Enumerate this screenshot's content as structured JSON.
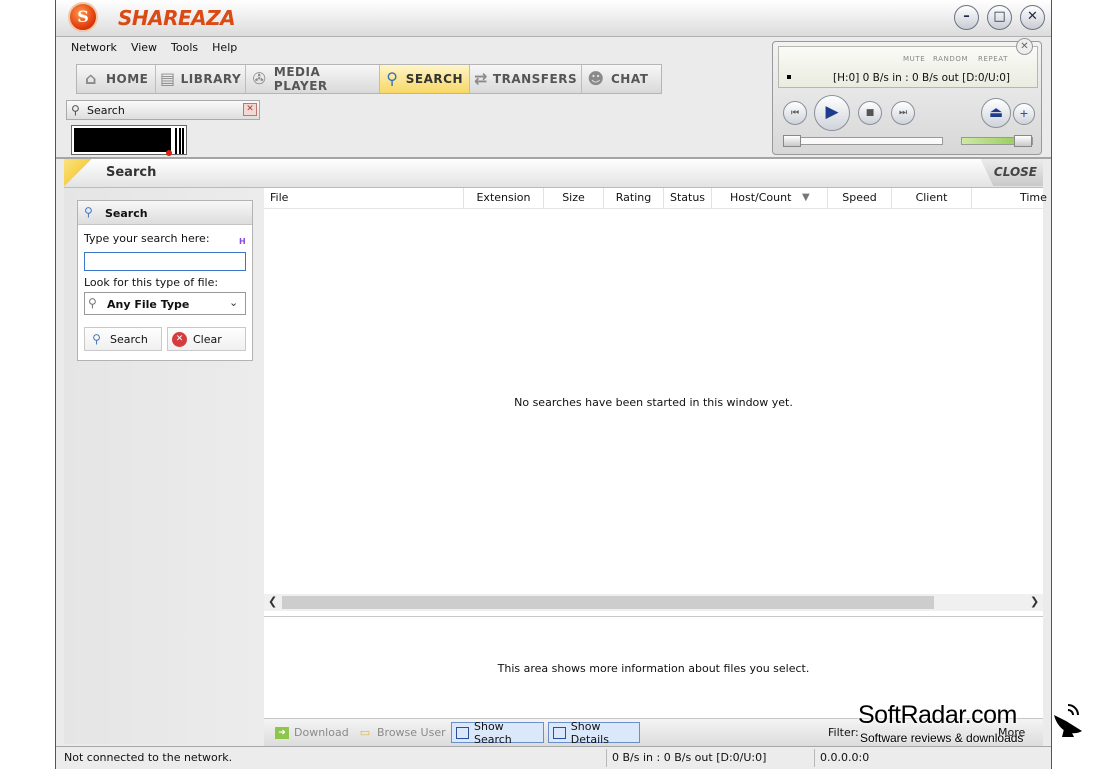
{
  "app": {
    "title": "SHAREAZA",
    "logo_letter": "S"
  },
  "window_controls": {
    "minimize": "–",
    "maximize": "□",
    "close": "✕"
  },
  "menu": [
    "Network",
    "View",
    "Tools",
    "Help"
  ],
  "nav": [
    {
      "label": "HOME",
      "icon": "house-icon"
    },
    {
      "label": "LIBRARY",
      "icon": "folders-icon"
    },
    {
      "label": "MEDIA PLAYER",
      "icon": "film-reel-icon"
    },
    {
      "label": "SEARCH",
      "icon": "magnifier-icon",
      "active": true
    },
    {
      "label": "TRANSFERS",
      "icon": "transfer-arrows-icon"
    },
    {
      "label": "CHAT",
      "icon": "chat-users-icon"
    }
  ],
  "tab": {
    "label": "Search"
  },
  "player": {
    "tags": {
      "mute": "MUTE",
      "random": "RANDOM",
      "repeat": "REPEAT"
    },
    "status": "[H:0] 0 B/s in : 0 B/s out [D:0/U:0]"
  },
  "panel": {
    "title": "Search",
    "close_label": "CLOSE"
  },
  "search_box": {
    "header": "Search",
    "prompt": "Type your search here:",
    "input_value": "",
    "input_placeholder": "",
    "type_label": "Look for this type of file:",
    "file_type": "Any File Type",
    "search_button": "Search",
    "clear_button": "Clear"
  },
  "results": {
    "columns": [
      "File",
      "Extension",
      "Size",
      "Rating",
      "Status",
      "Host/Count",
      "Speed",
      "Client",
      "Time"
    ],
    "sorted_column": "Host/Count",
    "empty_message": "No searches have been started in this window yet."
  },
  "details": {
    "message": "This area shows more information about files you select."
  },
  "bottom_toolbar": {
    "download": "Download",
    "browse_user": "Browse User",
    "show_search": "Show Search",
    "show_details": "Show Details",
    "filter": "Filter:",
    "more": "More"
  },
  "status_bar": {
    "main": "Not connected to the network.",
    "rate": "0 B/s in : 0 B/s out [D:0/U:0]",
    "ip": "0.0.0.0:0"
  },
  "watermark": {
    "title": "SoftRadar.com",
    "subtitle": "Software reviews & downloads"
  },
  "colors": {
    "brand": "#d94a14",
    "active_tab": "#f7d766",
    "accent_blue": "#3b76c9"
  }
}
